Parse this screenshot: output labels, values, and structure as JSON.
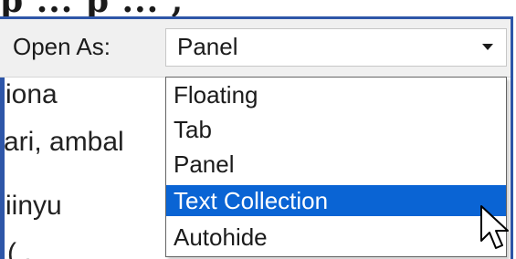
{
  "heading_partial": "p ... p ... ,",
  "toolbar": {
    "open_as_label": "Open As:",
    "combo_value": "Panel"
  },
  "background_text": [
    "iona",
    "ari, ambal",
    "iinyu",
    "( ."
  ],
  "dropdown": {
    "options": [
      "Floating",
      "Tab",
      "Panel",
      "Text Collection",
      "Autohide"
    ],
    "selected_index": 3
  },
  "colors": {
    "selection": "#0a64d4",
    "frame": "#2e56a8",
    "toolbar_bg": "#f0f0f0"
  },
  "icons": {
    "combo_arrow": "chevron-down-icon",
    "cursor": "mouse-pointer-icon"
  }
}
